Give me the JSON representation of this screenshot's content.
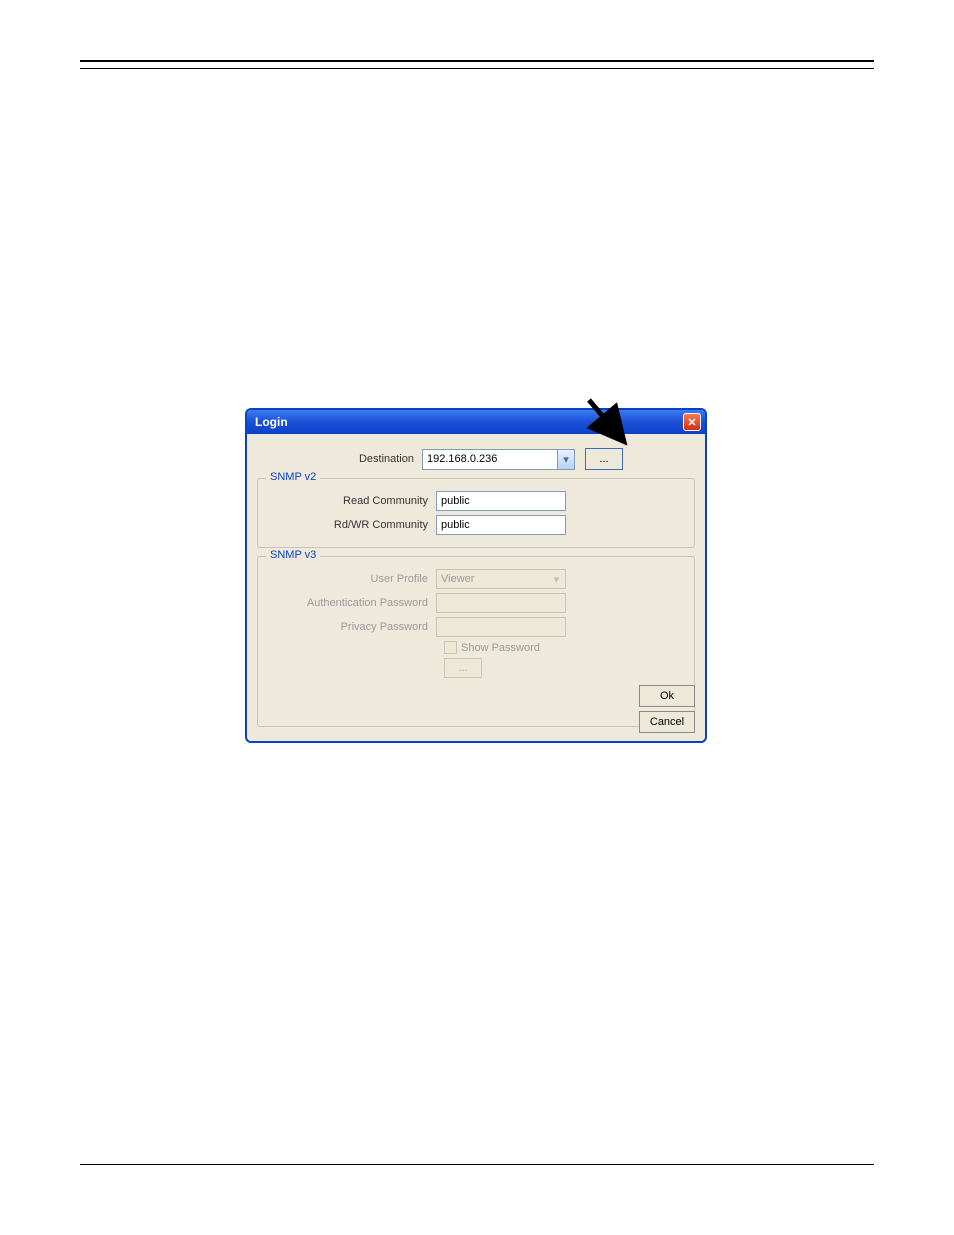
{
  "dialog": {
    "title": "Login",
    "destination_label": "Destination",
    "destination_value": "192.168.0.236",
    "browse_label": "...",
    "snmp_v2": {
      "legend": "SNMP v2",
      "read_label": "Read Community",
      "read_value": "public",
      "rdwr_label": "Rd/WR Community",
      "rdwr_value": "public"
    },
    "snmp_v3": {
      "legend": "SNMP v3",
      "user_profile_label": "User Profile",
      "user_profile_value": "Viewer",
      "auth_label": "Authentication Password",
      "priv_label": "Privacy Password",
      "show_pw_label": "Show Password",
      "more_label": "..."
    },
    "ok_label": "Ok",
    "cancel_label": "Cancel"
  }
}
